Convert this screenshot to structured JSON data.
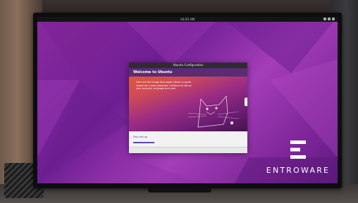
{
  "screen": {
    "clock": "10:03 AM",
    "brand": "ENTROWARE"
  },
  "dialog": {
    "title": "Ubuntu Configuration",
    "header": "Welcome to Ubuntu",
    "hero_text": "Here are the things that make Ubuntu a great choice for a new computer. Continue to set up your account, language and user.",
    "link": "Skip set-up"
  },
  "colors": {
    "wallpaper": "#8a2a9f",
    "dialog_header": "#5b2b74",
    "accent_orange": "#e2553b"
  }
}
